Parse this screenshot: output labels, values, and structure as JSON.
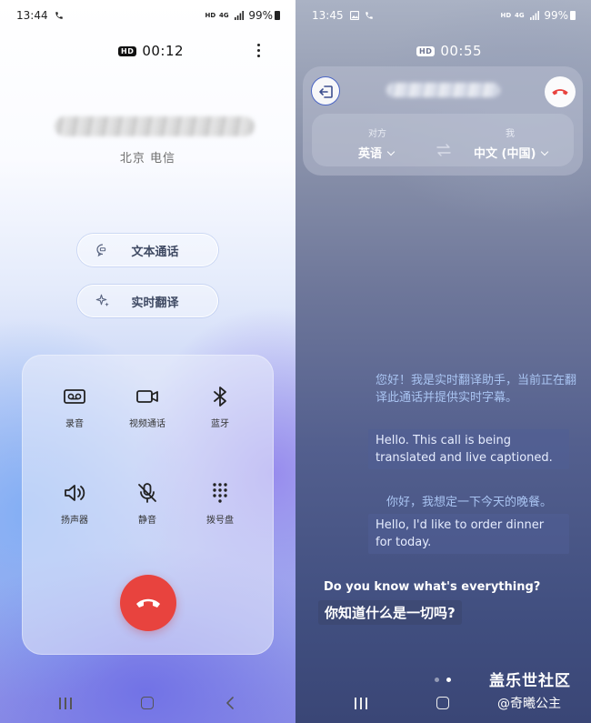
{
  "left_screen": {
    "status": {
      "time": "13:44",
      "hd": "HD",
      "net": "4G",
      "battery": "99%"
    },
    "call": {
      "hd_badge": "HD",
      "timer": "00:12",
      "carrier": "北京 电信"
    },
    "actions": [
      {
        "label": "文本通话",
        "icon": "chat-bubble-icon"
      },
      {
        "label": "实时翻译",
        "icon": "sparkle-icon"
      }
    ],
    "controls": [
      {
        "label": "录音",
        "icon": "voicemail-icon"
      },
      {
        "label": "视频通话",
        "icon": "video-camera-icon"
      },
      {
        "label": "蓝牙",
        "icon": "bluetooth-icon"
      },
      {
        "label": "扬声器",
        "icon": "speaker-icon"
      },
      {
        "label": "静音",
        "icon": "mic-off-icon"
      },
      {
        "label": "拨号盘",
        "icon": "dialpad-icon"
      }
    ],
    "end_call_color": "#e8433e"
  },
  "right_screen": {
    "status": {
      "time": "13:45",
      "hd": "HD",
      "net": "4G",
      "battery": "99%"
    },
    "call": {
      "hd_badge": "HD",
      "timer": "00:55"
    },
    "languages": {
      "their_caption": "对方",
      "their_lang": "英语",
      "my_caption": "我",
      "my_lang": "中文 (中国)"
    },
    "transcript": [
      {
        "kind": "system-zh",
        "text": "您好！我是实时翻译助手，当前正在翻译此通话并提供实时字幕。"
      },
      {
        "kind": "system-en",
        "text": "Hello. This call is being translated and live captioned."
      },
      {
        "kind": "mine-zh",
        "text": "你好，我想定一下今天的晚餐。"
      },
      {
        "kind": "mine-en",
        "text": "Hello, I'd like to order dinner for today."
      }
    ],
    "live": {
      "original": "Do you know what's everything?",
      "translation": "你知道什么是一切吗?"
    },
    "watermark": {
      "site": "盖乐世社区",
      "user": "@奇曦公主"
    }
  }
}
